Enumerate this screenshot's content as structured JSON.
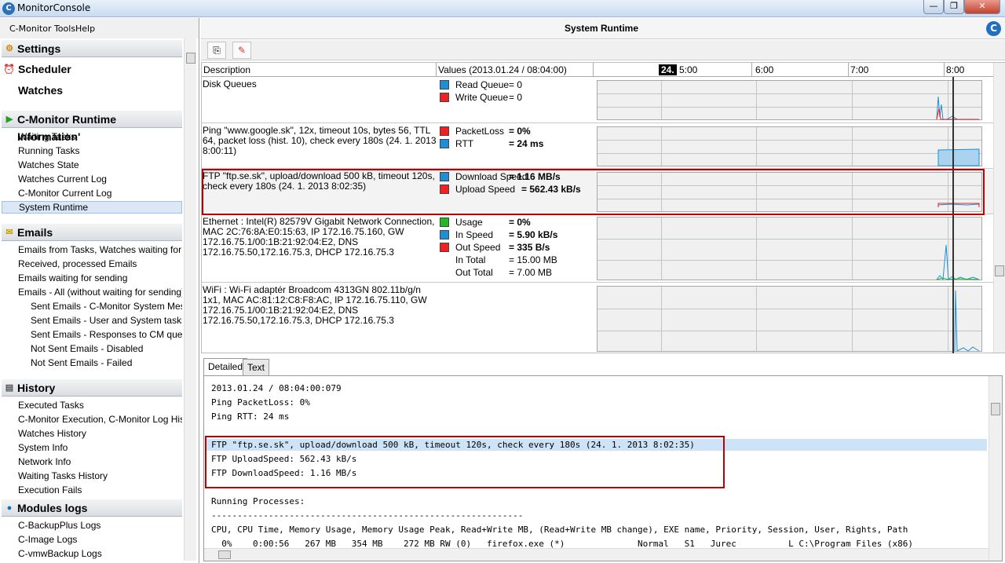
{
  "window": {
    "title": "MonitorConsole",
    "app_icon": "C",
    "min": "—",
    "max": "❐",
    "close": "✕"
  },
  "menu": {
    "tools": "C-Monitor Tools",
    "help": "Help"
  },
  "sidebar": {
    "settings": "Settings",
    "scheduler": "Scheduler",
    "watches": "Watches",
    "runtime_section": "C-Monitor Runtime Information'",
    "runtime_items": [
      "Waiting Tasks",
      "Running Tasks",
      "Watches State",
      "Watches Current Log",
      "C-Monitor Current Log",
      "System Runtime"
    ],
    "emails_section": "Emails",
    "email_items": [
      "Emails from Tasks, Watches waiting for send",
      "Received, processed Emails",
      "Emails waiting for sending",
      "Emails - All (without waiting for sending)"
    ],
    "email_sub_items": [
      "Sent Emails - C-Monitor System Message",
      "Sent Emails - User and System tasks Res",
      "Sent Emails - Responses to CM queries",
      "Not Sent Emails - Disabled",
      "Not Sent Emails - Failed"
    ],
    "history_section": "History",
    "history_items": [
      "Executed Tasks",
      "C-Monitor Execution, C-Monitor Log History",
      "Watches History",
      "System Info",
      "Network Info",
      "Waiting Tasks History",
      "Execution Fails"
    ],
    "modules_section": "Modules logs",
    "module_items": [
      "C-BackupPlus Logs",
      "C-Image Logs",
      "C-vmwBackup Logs"
    ]
  },
  "main": {
    "title": "System Runtime",
    "logo": "C",
    "columns": {
      "description": "Description",
      "values": "Values (2013.01.24 / 08:04:00)",
      "day": "24.",
      "t1": "5:00",
      "t2": "6:00",
      "t3": "7:00",
      "t4": "8:00"
    },
    "rows": [
      {
        "desc": "Disk Queues",
        "values": [
          {
            "name": "Read Queue",
            "value": "= 0",
            "color": "#1e8fd6",
            "bold": false
          },
          {
            "name": "Write Queue",
            "value": "= 0",
            "color": "#ee2222",
            "bold": false
          }
        ]
      },
      {
        "desc": "Ping \"www.google.sk\", 12x, timeout 10s, bytes 56, TTL 64, packet loss (hist. 10), check every 180s (24. 1. 2013 8:00:11)",
        "values": [
          {
            "name": "PacketLoss",
            "value": "= 0%",
            "color": "#ee2222",
            "bold": true
          },
          {
            "name": "RTT",
            "value": "= 24 ms",
            "color": "#1e8fd6",
            "bold": true
          }
        ]
      },
      {
        "desc": "FTP \"ftp.se.sk\", upload/download 500 kB, timeout 120s, check every 180s (24. 1. 2013 8:02:35)",
        "values": [
          {
            "name": "Download Speed",
            "value": "= 1.16 MB/s",
            "color": "#1e8fd6",
            "bold": true
          },
          {
            "name": "Upload Speed",
            "value": "= 562.43 kB/s",
            "color": "#ee2222",
            "bold": true
          }
        ]
      },
      {
        "desc": "Ethernet : Intel(R) 82579V Gigabit Network Connection, MAC 2C:76:8A:E0:15:63, IP 172.16.75.160, GW 172.16.75.1/00:1B:21:92:04:E2, DNS 172.16.75.50,172.16.75.3, DHCP 172.16.75.3",
        "values": [
          {
            "name": "Usage",
            "value": "= 0%",
            "color": "#22bb22",
            "bold": true
          },
          {
            "name": "In Speed",
            "value": "= 5.90 kB/s",
            "color": "#1e8fd6",
            "bold": true
          },
          {
            "name": "Out Speed",
            "value": "= 335 B/s",
            "color": "#ee2222",
            "bold": true
          },
          {
            "name": "In Total",
            "value": "= 15.00 MB",
            "color": "",
            "bold": false
          },
          {
            "name": "Out Total",
            "value": "= 7.00 MB",
            "color": "",
            "bold": false
          }
        ]
      },
      {
        "desc": "WiFi : Wi-Fi adaptér Broadcom 4313GN 802.11b/g/n 1x1, MAC AC:81:12:C8:F8:AC, IP 172.16.75.110, GW 172.16.75.1/00:1B:21:92:04:E2, DNS 172.16.75.50,172.16.75.3, DHCP 172.16.75.3",
        "values": []
      }
    ],
    "tabs": [
      "Detailed",
      "Text"
    ],
    "detail_lines": [
      "2013.01.24 / 08:04:00:079",
      "Ping PacketLoss: 0%",
      "Ping RTT: 24 ms",
      "",
      "FTP \"ftp.se.sk\", upload/download 500 kB, timeout 120s, check every 180s (24. 1. 2013 8:02:35)",
      "FTP UploadSpeed: 562.43 kB/s",
      "FTP DownloadSpeed: 1.16 MB/s",
      "",
      "Running Processes:",
      "------------------------------------------------------------",
      "CPU, CPU Time, Memory Usage, Memory Usage Peak, Read+Write MB, (Read+Write MB change), EXE name, Priority, Session, User, Rights, Path",
      "  0%    0:00:56   267 MB   354 MB    272 MB RW (0)   firefox.exe (*)              Normal   S1   Jurec          L C:\\Program Files (x86)"
    ]
  }
}
